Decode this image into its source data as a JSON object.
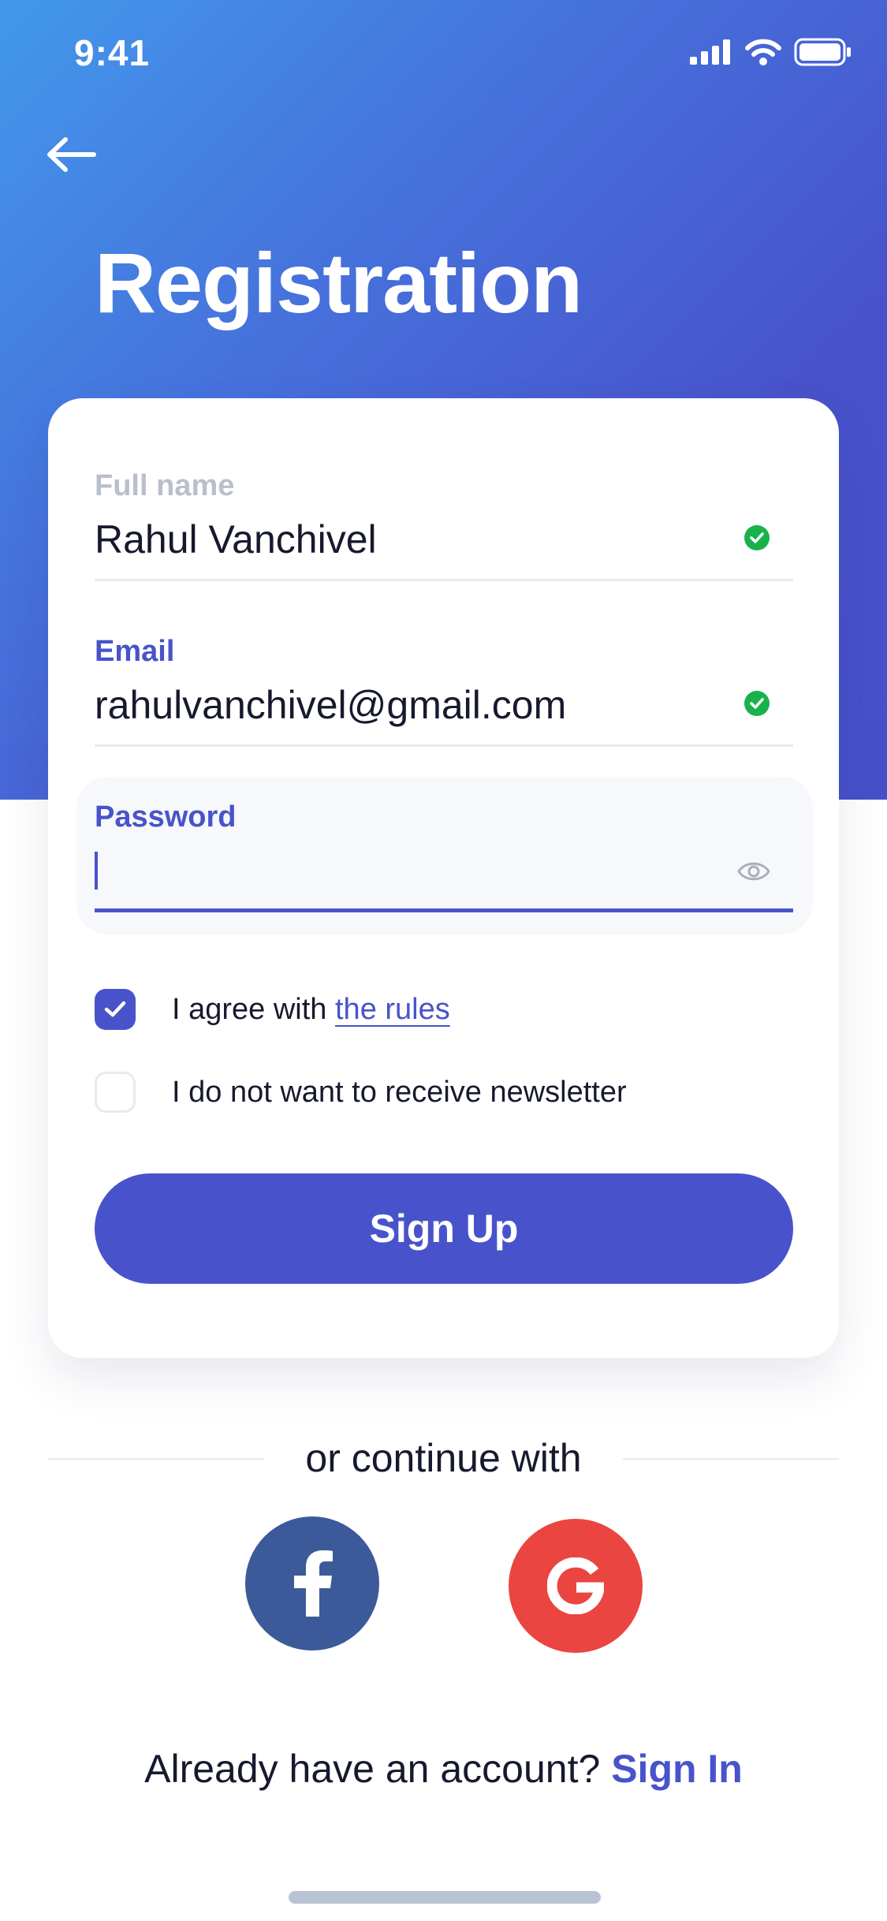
{
  "status_bar": {
    "time": "9:41",
    "icons": [
      "cellular-signal-icon",
      "wifi-icon",
      "battery-icon"
    ]
  },
  "header": {
    "back_icon": "arrow-left-icon",
    "title": "Registration"
  },
  "form": {
    "full_name": {
      "label": "Full name",
      "value": "Rahul Vanchivel",
      "status_icon": "valid-check-icon"
    },
    "email": {
      "label": "Email",
      "value": "rahulvanchivel@gmail.com",
      "status_icon": "valid-check-icon"
    },
    "password": {
      "label": "Password",
      "value": "",
      "toggle_icon": "eye-icon"
    },
    "agree_rules": {
      "checked": true,
      "text": "I agree with ",
      "link": "the rules"
    },
    "newsletter_opt_out": {
      "checked": false,
      "text": "I do not want to receive newsletter"
    },
    "submit_label": "Sign Up"
  },
  "social": {
    "divider_text": "or continue with",
    "providers": [
      {
        "name": "facebook",
        "icon": "facebook-icon",
        "color": "#3c5a99"
      },
      {
        "name": "google",
        "icon": "google-icon",
        "color": "#ea4540"
      }
    ]
  },
  "footer": {
    "prompt": "Already have an account? ",
    "link": "Sign In"
  },
  "colors": {
    "primary": "#4853cb",
    "gradient_start": "#4298ec",
    "success": "#18b24a",
    "label_muted": "#b9bfcb",
    "text_dark": "#17192e"
  }
}
